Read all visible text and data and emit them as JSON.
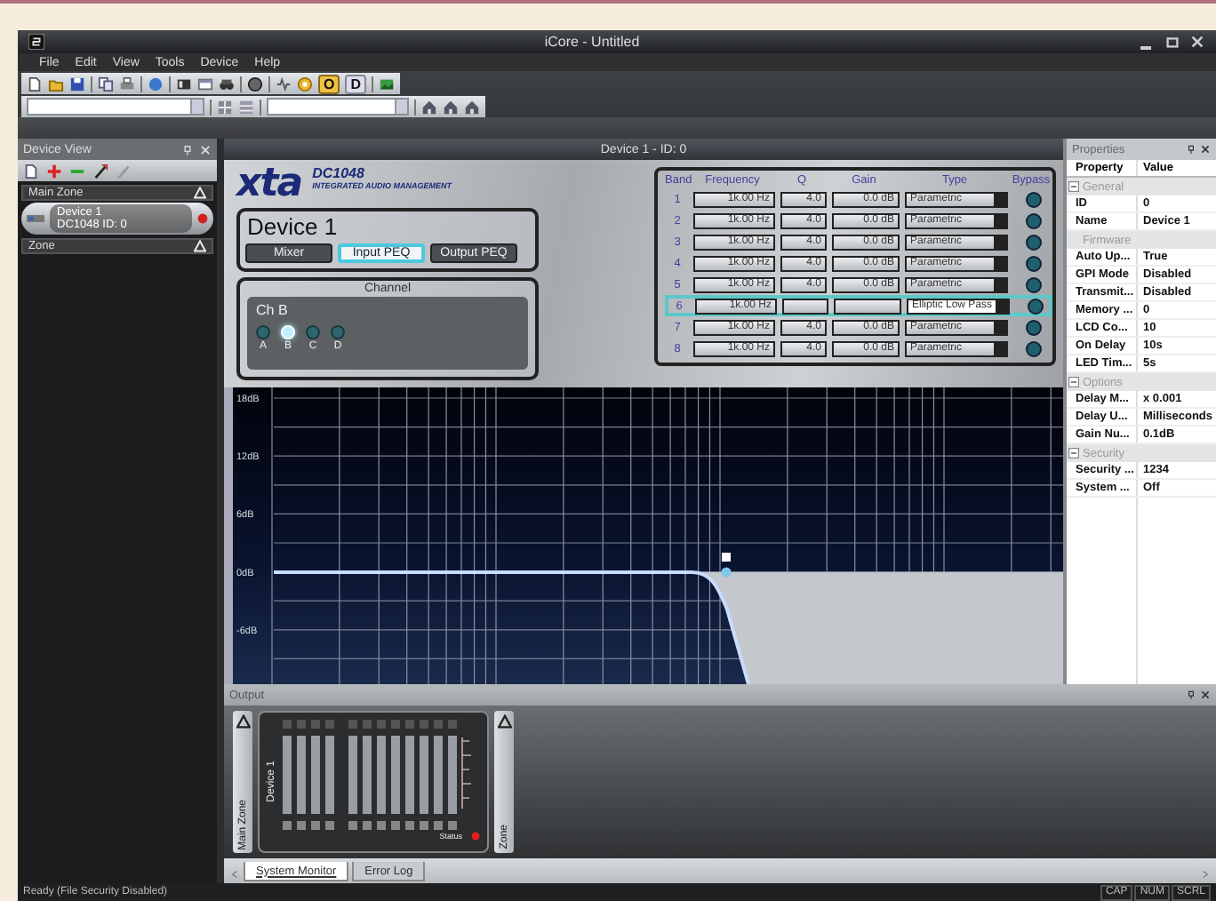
{
  "window": {
    "title": "iCore - Untitled"
  },
  "menu": [
    "File",
    "Edit",
    "View",
    "Tools",
    "Device",
    "Help"
  ],
  "toolbar_buttons": [
    "O",
    "D"
  ],
  "device_view": {
    "title": "Device View",
    "zones": [
      {
        "name": "Main Zone",
        "devices": [
          {
            "name": "Device 1",
            "detail": "DC1048  ID: 0",
            "selected": true
          }
        ]
      },
      {
        "name": "Zone"
      }
    ]
  },
  "document": {
    "tab": "Device 1 - ID: 0",
    "logo": "xta",
    "model": "DC1048",
    "tagline": "INTEGRATED AUDIO MANAGEMENT",
    "device_name": "Device 1",
    "views": [
      {
        "label": "Mixer",
        "selected": false
      },
      {
        "label": "Input PEQ",
        "selected": true
      },
      {
        "label": "Output PEQ",
        "selected": false
      }
    ],
    "channel": {
      "title": "Channel",
      "current": "Ch B",
      "options": [
        {
          "label": "A",
          "selected": false
        },
        {
          "label": "B",
          "selected": true
        },
        {
          "label": "C",
          "selected": false
        },
        {
          "label": "D",
          "selected": false
        }
      ]
    },
    "bands": {
      "columns": [
        "Band",
        "Frequency",
        "Q",
        "Gain",
        "Type",
        "Bypass"
      ],
      "rows": [
        {
          "band": "1",
          "frequency": "1k.00 Hz",
          "q": "4.0",
          "gain": "0.0 dB",
          "type": "Parametric",
          "selected": false
        },
        {
          "band": "2",
          "frequency": "1k.00 Hz",
          "q": "4.0",
          "gain": "0.0 dB",
          "type": "Parametric",
          "selected": false
        },
        {
          "band": "3",
          "frequency": "1k.00 Hz",
          "q": "4.0",
          "gain": "0.0 dB",
          "type": "Parametric",
          "selected": false
        },
        {
          "band": "4",
          "frequency": "1k.00 Hz",
          "q": "4.0",
          "gain": "0.0 dB",
          "type": "Parametric",
          "selected": false
        },
        {
          "band": "5",
          "frequency": "1k.00 Hz",
          "q": "4.0",
          "gain": "0.0 dB",
          "type": "Parametric",
          "selected": false
        },
        {
          "band": "6",
          "frequency": "1k.00 Hz",
          "type": "Elliptic Low Pass",
          "selected": true
        },
        {
          "band": "7",
          "frequency": "1k.00 Hz",
          "q": "4.0",
          "gain": "0.0 dB",
          "type": "Parametric",
          "selected": false
        },
        {
          "band": "8",
          "frequency": "1k.00 Hz",
          "q": "4.0",
          "gain": "0.0 dB",
          "type": "Parametric",
          "selected": false
        }
      ]
    },
    "graph": {
      "y_labels": [
        "18dB",
        "12dB",
        "6dB",
        "0dB",
        "-6dB"
      ]
    }
  },
  "properties": {
    "title": "Properties",
    "columns": [
      "Property",
      "Value"
    ],
    "groups": [
      {
        "name": "General",
        "kind": "category",
        "rows": [
          {
            "property": "ID",
            "value": "0"
          },
          {
            "property": "Name",
            "value": "Device 1"
          }
        ]
      },
      {
        "name": "Firmware",
        "kind": "subcategory",
        "rows": [
          {
            "property": "Auto Up...",
            "value": "True"
          },
          {
            "property": "GPI Mode",
            "value": "Disabled"
          },
          {
            "property": "Transmit...",
            "value": "Disabled"
          },
          {
            "property": "Memory ...",
            "value": "0"
          },
          {
            "property": "LCD Co...",
            "value": "10"
          },
          {
            "property": "On Delay",
            "value": "10s"
          },
          {
            "property": "LED Tim...",
            "value": "5s"
          }
        ]
      },
      {
        "name": "Options",
        "kind": "category",
        "rows": [
          {
            "property": "Delay M...",
            "value": "x 0.001"
          },
          {
            "property": "Delay U...",
            "value": "Milliseconds"
          },
          {
            "property": "Gain Nu...",
            "value": "0.1dB"
          }
        ]
      },
      {
        "name": "Security",
        "kind": "category",
        "rows": [
          {
            "property": "Security ...",
            "value": "1234"
          },
          {
            "property": "System ...",
            "value": "Off"
          }
        ]
      }
    ]
  },
  "output": {
    "title": "Output",
    "zones": [
      "Main Zone",
      "Zone"
    ],
    "device": {
      "name": "Device 1",
      "status": "Status"
    },
    "tabs": [
      {
        "label": "System Monitor",
        "selected": true
      },
      {
        "label": "Error Log",
        "selected": false
      }
    ]
  },
  "status_bar": {
    "text": "Ready (File Security Disabled)",
    "indicators": [
      "CAP",
      "NUM",
      "SCRL"
    ]
  }
}
